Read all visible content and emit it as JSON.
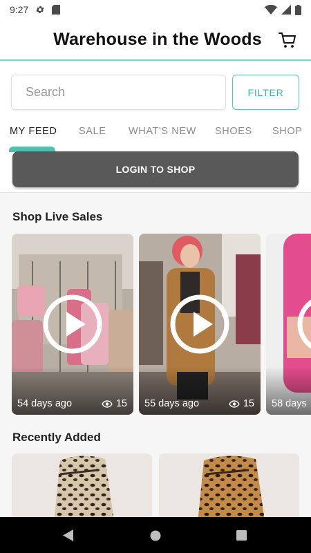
{
  "status_bar": {
    "time": "9:27"
  },
  "header": {
    "title": "Warehouse in the Woods",
    "cart_icon": "cart-icon"
  },
  "search": {
    "placeholder": "Search",
    "value": ""
  },
  "filter": {
    "label": "FILTER"
  },
  "tabs": [
    {
      "label": "MY FEED",
      "active": true
    },
    {
      "label": "SALE"
    },
    {
      "label": "WHAT'S NEW"
    },
    {
      "label": "SHOES"
    },
    {
      "label": "SHOP"
    }
  ],
  "login": {
    "label": "LOGIN TO SHOP"
  },
  "live_sales": {
    "title": "Shop Live Sales",
    "items": [
      {
        "days": "54 days ago",
        "views": "15"
      },
      {
        "days": "55 days ago",
        "views": "15"
      },
      {
        "days": "58 days"
      }
    ]
  },
  "recently_added": {
    "title": "Recently Added"
  },
  "colors": {
    "accent": "#4fc0b3",
    "button_dark": "#595959",
    "content_bg": "#f6f6f6"
  }
}
